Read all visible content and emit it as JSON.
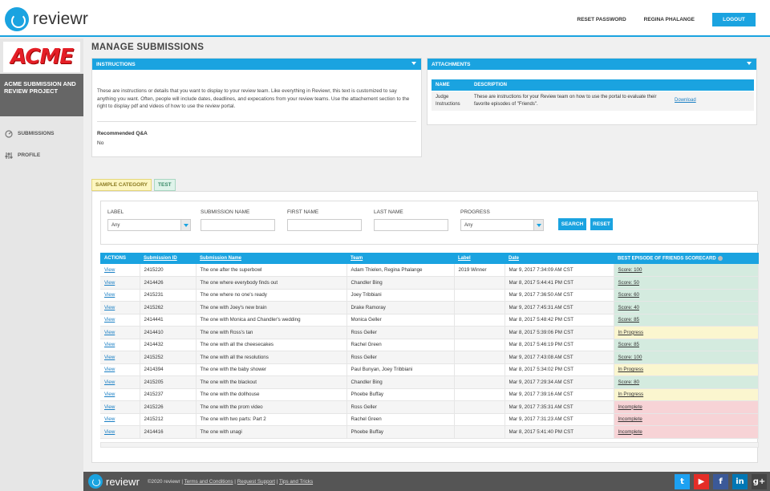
{
  "app": {
    "name": "reviewr"
  },
  "header": {
    "reset_password": "RESET PASSWORD",
    "user": "REGINA PHALANGE",
    "logout": "LOGOUT"
  },
  "sidebar": {
    "brand": "ACME",
    "project": "ACME SUBMISSION AND REVIEW PROJECT",
    "items": [
      {
        "label": "SUBMISSIONS",
        "icon": "gauge-icon"
      },
      {
        "label": "PROFILE",
        "icon": "sliders-icon"
      }
    ]
  },
  "page": {
    "title": "MANAGE SUBMISSIONS"
  },
  "instructions": {
    "title": "INSTRUCTIONS",
    "text": "These are instructions or details that you want to display to your review team. Like everything in Reviewr, this text is customized to say anything you want. Often, people will include dates, deadlines, and expecations from your review teams. Use the attachement section to the right to display pdf and videos of how to use the review portal.",
    "qa_label": "Recommended Q&A",
    "qa_value": "No"
  },
  "attachments": {
    "title": "ATTACHMENTS",
    "headers": [
      "NAME",
      "DESCRIPTION",
      ""
    ],
    "rows": [
      {
        "name": "Judge Instructions",
        "description": "These are instructions for your Review team on how to use the portal to evaluate their favorite episodes of \"Friends\".",
        "action": "Download"
      }
    ]
  },
  "tabs": [
    {
      "label": "SAMPLE CATEGORY"
    },
    {
      "label": "TEST"
    }
  ],
  "filters": {
    "label": {
      "label": "LABEL",
      "value": "Any"
    },
    "submission_name": {
      "label": "SUBMISSION NAME",
      "value": ""
    },
    "first_name": {
      "label": "FIRST NAME",
      "value": ""
    },
    "last_name": {
      "label": "LAST NAME",
      "value": ""
    },
    "progress": {
      "label": "PROGRESS",
      "value": "Any"
    },
    "search": "SEARCH",
    "reset": "RESET"
  },
  "table": {
    "headers": [
      "ACTIONS",
      "Submission ID",
      "Submission Name",
      "Team",
      "Label",
      "Date",
      "BEST EPISODE OF FRIENDS SCORECARD"
    ],
    "rows": [
      {
        "action": "View",
        "id": "2415220",
        "name": "The one after the superbowl",
        "team": "Adam Thielen, Regina Phalange",
        "label": "2019 Winner",
        "date": "Mar 9, 2017 7:34:09 AM CST",
        "score": "Score: 100",
        "status": "green"
      },
      {
        "action": "View",
        "id": "2414426",
        "name": "The one where everybody finds out",
        "team": "Chandler Bing",
        "label": "",
        "date": "Mar 8, 2017 5:44:41 PM CST",
        "score": "Score: 50",
        "status": "green"
      },
      {
        "action": "View",
        "id": "2415231",
        "name": "The one where no one's ready",
        "team": "Joey Tribbiani",
        "label": "",
        "date": "Mar 9, 2017 7:36:50 AM CST",
        "score": "Score: 60",
        "status": "green"
      },
      {
        "action": "View",
        "id": "2415262",
        "name": "The one with Joey's new brain",
        "team": "Drake Ramoray",
        "label": "",
        "date": "Mar 9, 2017 7:45:31 AM CST",
        "score": "Score: 40",
        "status": "green"
      },
      {
        "action": "View",
        "id": "2414441",
        "name": "The one with Monica and Chandler's wedding",
        "team": "Monica Geller",
        "label": "",
        "date": "Mar 8, 2017 5:48:42 PM CST",
        "score": "Score: 85",
        "status": "green"
      },
      {
        "action": "View",
        "id": "2414410",
        "name": "The one with Ross's tan",
        "team": "Ross Geller",
        "label": "",
        "date": "Mar 8, 2017 5:39:06 PM CST",
        "score": "In Progress",
        "status": "yellow"
      },
      {
        "action": "View",
        "id": "2414432",
        "name": "The one with all the cheesecakes",
        "team": "Rachel Green",
        "label": "",
        "date": "Mar 8, 2017 5:46:19 PM CST",
        "score": "Score: 85",
        "status": "green"
      },
      {
        "action": "View",
        "id": "2415252",
        "name": "The one with all the resolutions",
        "team": "Ross Geller",
        "label": "",
        "date": "Mar 9, 2017 7:43:08 AM CST",
        "score": "Score: 100",
        "status": "green"
      },
      {
        "action": "View",
        "id": "2414394",
        "name": "The one with the baby shower",
        "team": "Paul Bunyan, Joey Tribbiani",
        "label": "",
        "date": "Mar 8, 2017 5:34:02 PM CST",
        "score": "In Progress",
        "status": "yellow"
      },
      {
        "action": "View",
        "id": "2415205",
        "name": "The one with the blackout",
        "team": "Chandler Bing",
        "label": "",
        "date": "Mar 9, 2017 7:29:34 AM CST",
        "score": "Score: 80",
        "status": "green"
      },
      {
        "action": "View",
        "id": "2415237",
        "name": "The one with the dollhouse",
        "team": "Phoebe Buffay",
        "label": "",
        "date": "Mar 9, 2017 7:39:16 AM CST",
        "score": "In Progress",
        "status": "yellow"
      },
      {
        "action": "View",
        "id": "2415226",
        "name": "The one with the prom video",
        "team": "Ross Geller",
        "label": "",
        "date": "Mar 9, 2017 7:35:31 AM CST",
        "score": "Incomplete",
        "status": "red"
      },
      {
        "action": "View",
        "id": "2415212",
        "name": "The one with two parts: Part 2",
        "team": "Rachel Green",
        "label": "",
        "date": "Mar 9, 2017 7:31:23 AM CST",
        "score": "Incomplete",
        "status": "red"
      },
      {
        "action": "View",
        "id": "2414416",
        "name": "The one with unagi",
        "team": "Phoebe Buffay",
        "label": "",
        "date": "Mar 8, 2017 5:41:40 PM CST",
        "score": "Incomplete",
        "status": "red"
      }
    ]
  },
  "footer": {
    "brand": "reviewr",
    "copyright": "©2020 reviewr",
    "links": [
      "Terms and Conditions",
      "Request Support",
      "Tips and Tricks"
    ],
    "social": [
      {
        "icon": "twitter-icon",
        "glyph": "t",
        "color": "#1da1f2"
      },
      {
        "icon": "youtube-icon",
        "glyph": "▶",
        "color": "#e52d27"
      },
      {
        "icon": "facebook-icon",
        "glyph": "f",
        "color": "#3b5998"
      },
      {
        "icon": "linkedin-icon",
        "glyph": "in",
        "color": "#0077b5"
      },
      {
        "icon": "googleplus-icon",
        "glyph": "g+",
        "color": "#444444"
      }
    ]
  },
  "colors": {
    "accent": "#1aa3e0",
    "brand_red": "#e41e26",
    "green": "#d4ebdf",
    "yellow": "#fbf6cf",
    "red": "#f7d3d6"
  }
}
